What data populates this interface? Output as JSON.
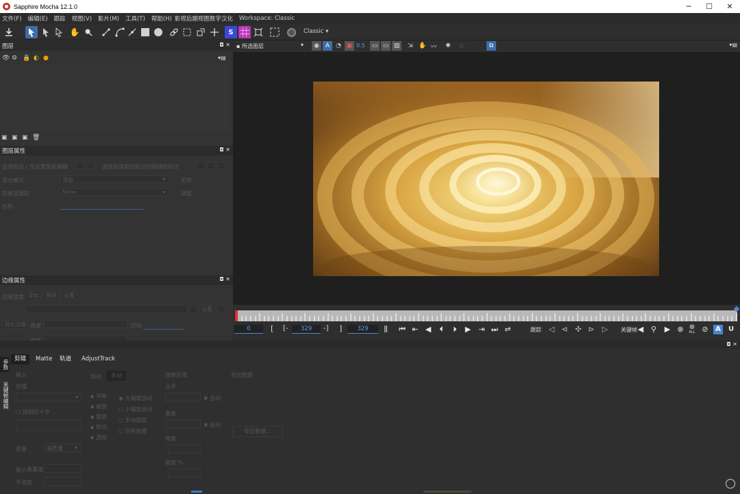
{
  "window": {
    "title": "Sapphire Mocha 12.1.0",
    "minimize": "─",
    "maximize": "☐",
    "close": "✕"
  },
  "menu": {
    "items": [
      "文件(F)",
      "编辑(E)",
      "跟踪",
      "视图(V)",
      "影片(M)",
      "工具(T)",
      "帮助(H)"
    ],
    "extra": "影视后期视图数字汉化",
    "workspace": "Workspace: Classic"
  },
  "toolbar": {
    "workspace_select": "Classic",
    "icons": [
      "export-icon",
      "select-arrow-icon",
      "select-add-icon",
      "select-point-icon",
      "hand-icon",
      "zoom-icon",
      "xspline-icon",
      "bezier-icon",
      "add-point-icon",
      "rect-tool-icon",
      "ellipse-tool-icon",
      "link-icon",
      "align-icon",
      "transform-icon",
      "move-icon",
      "surface-icon",
      "grid-icon",
      "adjust-icon",
      "crop-icon",
      "stabilize-icon"
    ]
  },
  "layers_panel": {
    "title": "图层",
    "col_icons": [
      "eye-icon",
      "gear-icon",
      "lock-icon",
      "moon-icon",
      "color-icon"
    ]
  },
  "layer_props": {
    "title": "图层属性",
    "row1_label": "选择图层 / 在设置面板编辑",
    "row1_label2": "选择图层和控制点时跟随控制点",
    "blend_label": "混合模式",
    "blend_value": "添加",
    "blend_extra": "反转",
    "link_label": "链接至跟踪",
    "link_value": "None",
    "link_extra": "调整",
    "name_label": "名称"
  },
  "edge_props": {
    "title": "边缘属性",
    "width_label": "边缘宽度",
    "btn_a": "添加",
    "btn_b": "删除",
    "btn_c": "设置",
    "angle_label": "角度",
    "offset_label": "偏移",
    "feather_btn": "羽化边缘",
    "feather_label": "控制"
  },
  "viewer": {
    "view_select": "所选图层",
    "opacity": "0.5"
  },
  "timeline": {
    "current_frame": "0",
    "in_bracket": "[",
    "in_dash": "[-",
    "in_value": "329",
    "out_dash": "-]",
    "out_bracket": "]",
    "end_value": "329",
    "track_label": "跟踪",
    "keyframe_label": "关键帧",
    "all_label": "ALL",
    "auto_label": "A",
    "u_label": "U"
  },
  "bottom": {
    "side_tab_1": "参数",
    "side_tab_2": "关键帧编辑",
    "tabs": [
      "剪辑",
      "Matte",
      "轨道",
      "AdjustTrack"
    ],
    "input_label": "输入",
    "clip_label": "剪辑",
    "checkbox_label": "预跟踪十字",
    "auto_tab": "自动",
    "manual_tab": "手动",
    "track_options": [
      "平移",
      "缩放",
      "旋转",
      "剪切",
      "透视"
    ],
    "motion_options": [
      "大幅度运动",
      "小幅度运动",
      "手动跟踪",
      "现有数据"
    ],
    "search_area": "搜索区域",
    "horizontal_label": "水平",
    "vertical_label": "垂直",
    "angle_label": "角度",
    "zoom_label": "缩放 %",
    "auto_check": "自动",
    "min_pixels": "最小像素值",
    "accuracy": "平滑度",
    "quality_label": "质量",
    "quality_value": "高质量",
    "export_label": "导出数据",
    "export_btn": "导出数据..."
  }
}
